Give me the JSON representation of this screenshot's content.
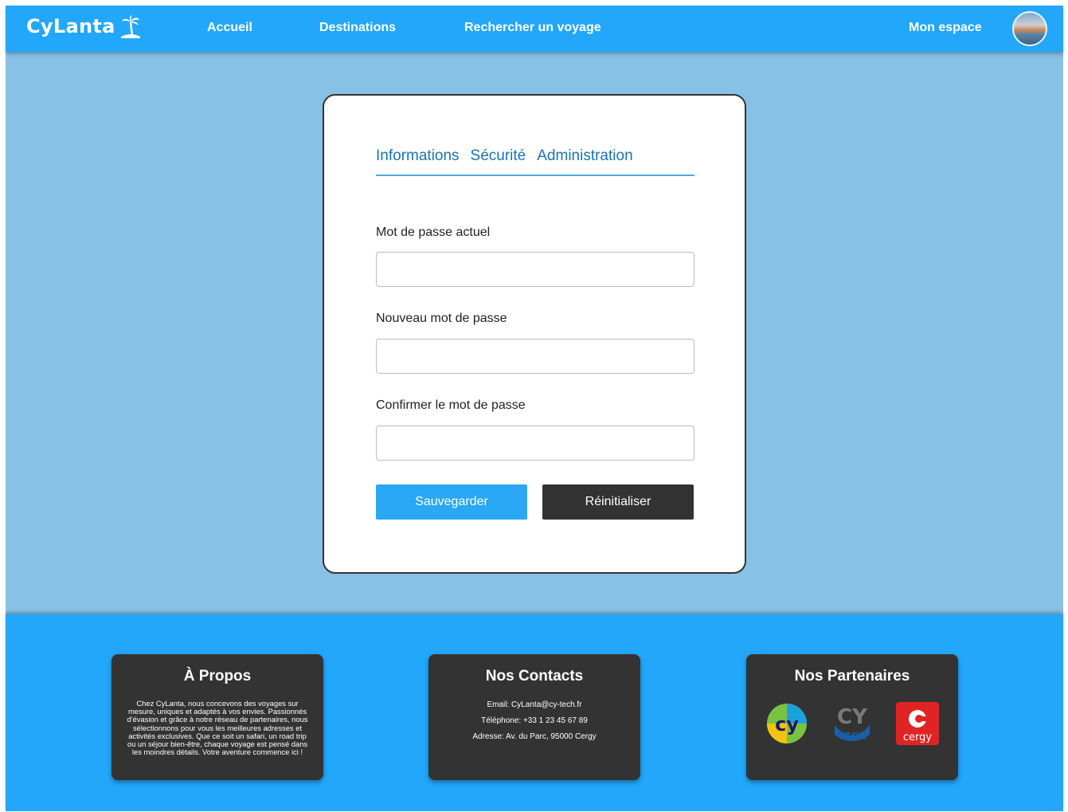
{
  "header": {
    "logo_text": "CyLanta",
    "nav": [
      "Accueil",
      "Destinations",
      "Rechercher un voyage"
    ],
    "account_link": "Mon espace"
  },
  "card": {
    "tabs": [
      "Informations",
      "Sécurité",
      "Administration"
    ],
    "fields": [
      {
        "label": "Mot de passe actuel",
        "value": ""
      },
      {
        "label": "Nouveau mot de passe",
        "value": ""
      },
      {
        "label": "Confirmer le mot de passe",
        "value": ""
      }
    ],
    "save_label": "Sauvegarder",
    "reset_label": "Réinitialiser"
  },
  "footer": {
    "about": {
      "title": "À Propos",
      "text": "Chez CyLanta, nous concevons des voyages sur mesure, uniques et adaptés à vos envies. Passionnés d'évasion et grâce à notre réseau de partenaires, nous sélectionnons pour vous les meilleures adresses et activités exclusives. Que ce soit un safari, un road trip ou un séjour bien-être, chaque voyage est pensé dans les moindres détails. Votre aventure commence ici !"
    },
    "contacts": {
      "title": "Nos Contacts",
      "email": "Email: CyLanta@cy-tech.fr",
      "phone": "Téléphone: +33 1 23 45 67 89",
      "address": "Adresse: Av. du Parc, 95000 Cergy"
    },
    "partners": {
      "title": "Nos Partenaires",
      "logos": [
        {
          "icon": "cy-logo",
          "text": "cy"
        },
        {
          "icon": "cy-tech-logo",
          "text": "CY TECH"
        },
        {
          "icon": "cergy-logo",
          "text": "cergy"
        }
      ]
    }
  },
  "colors": {
    "primary": "#22a7fa",
    "background": "#87c1e6",
    "dark": "#333333",
    "tab_text": "#1b74ad"
  }
}
